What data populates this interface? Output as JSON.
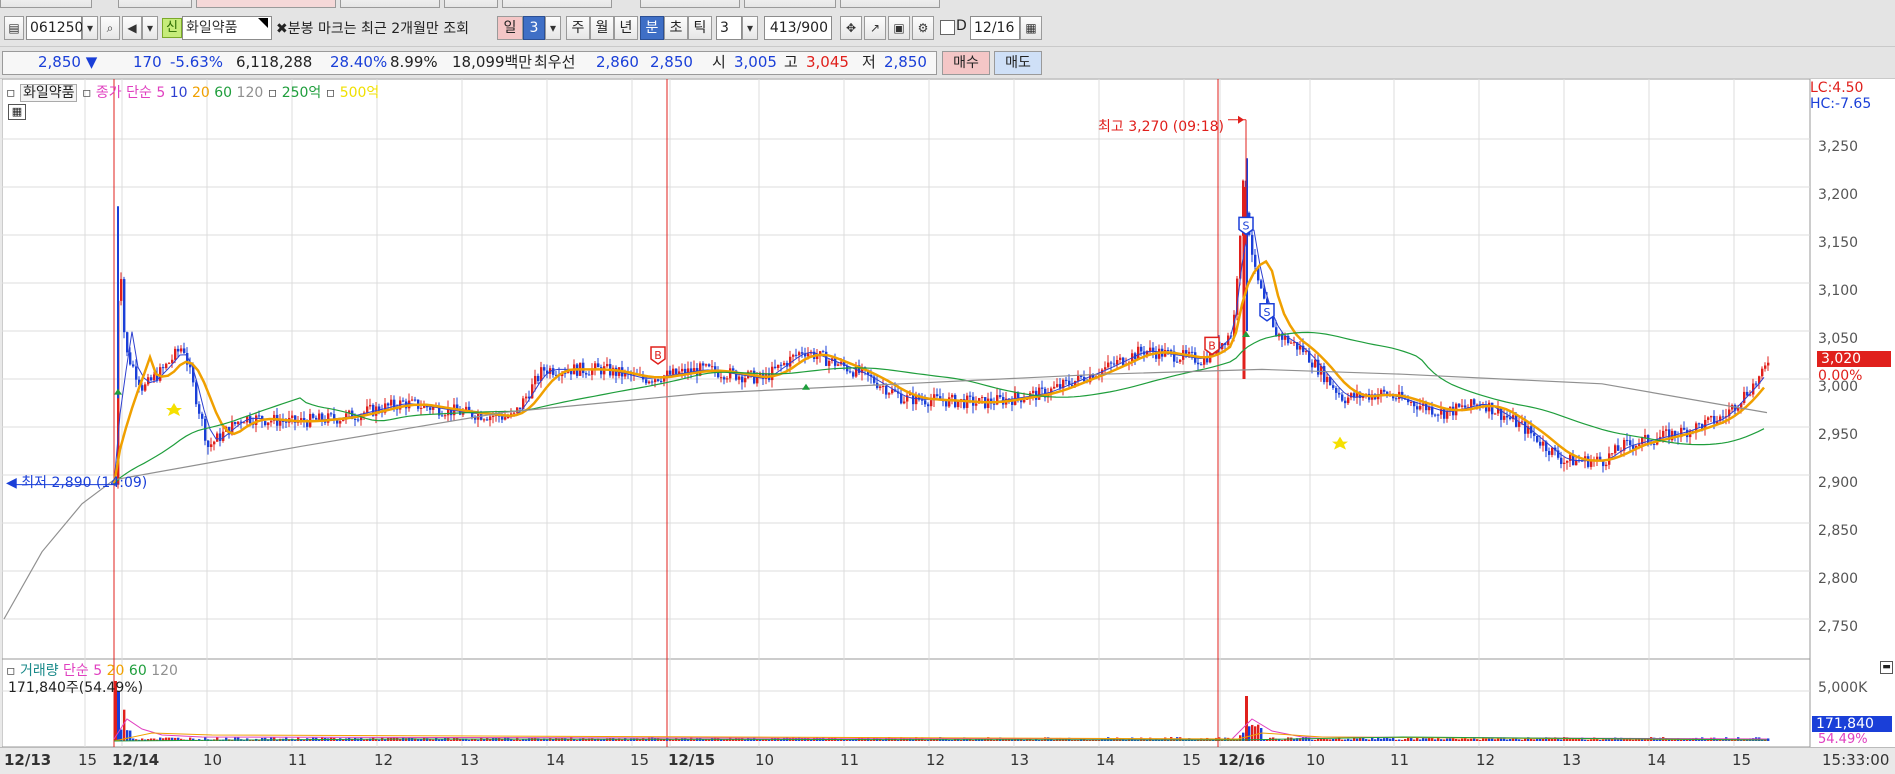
{
  "toolbar": {
    "code": "061250",
    "company": "화일약품",
    "notice": "분봉 마크는 최근 2개월만 조회",
    "period_day": "일",
    "period_num": "3",
    "period_week": "주",
    "period_month": "월",
    "period_year": "년",
    "period_min": "분",
    "period_sec": "초",
    "period_tick": "틱",
    "tick_num": "3",
    "count": "413",
    "count_total": "/900",
    "date": "12/16",
    "date_prefix": "D",
    "new_badge": "신"
  },
  "quote": {
    "price": "2,850",
    "change": "170",
    "change_pct": "-5.63%",
    "volume": "6,118,288",
    "vol_ratio": "28.40%",
    "turnover": "8.99%",
    "amount": "18,099백만",
    "best_label": "최우선",
    "ask": "2,860",
    "bid": "2,850",
    "open_label": "시",
    "open": "3,005",
    "high_label": "고",
    "high": "3,045",
    "low_label": "저",
    "low": "2,850",
    "buy": "매수",
    "sell": "매도"
  },
  "legend": {
    "name": "화일약품",
    "close_label": "종가 단순",
    "ma5": "5",
    "ma10": "10",
    "ma20": "20",
    "ma60": "60",
    "ma120": "120",
    "ma_250": "250억",
    "ma_500": "500억"
  },
  "annotations": {
    "high": "최고 3,270 (09:18)",
    "low": "최저 2,890 (14:09)",
    "lc": "LC:4.50",
    "hc": "HC:-7.65",
    "price_tag": "3,020",
    "pct_tag": "0.00%"
  },
  "yaxis": [
    "3,250",
    "3,200",
    "3,150",
    "3,100",
    "3,050",
    "3,000",
    "2,950",
    "2,900",
    "2,850",
    "2,800",
    "2,750"
  ],
  "volume_panel": {
    "legend_vol": "거래량",
    "legend_simple": "단순",
    "legend_5": "5",
    "legend_20": "20",
    "legend_60": "60",
    "legend_120": "120",
    "info": "171,840주(54.49%)",
    "axis_top": "5,000K",
    "vol_tag": "171,840",
    "vol_pct": "54.49%"
  },
  "xaxis": {
    "labels": [
      "12/13",
      "15",
      "12/14",
      "10",
      "11",
      "12",
      "13",
      "14",
      "15",
      "12/15",
      "10",
      "11",
      "12",
      "13",
      "14",
      "15",
      "12/16",
      "10",
      "11",
      "12",
      "13",
      "14",
      "15"
    ],
    "time": "15:33:00"
  },
  "colors": {
    "up": "#e0201c",
    "down": "#1a3fd8",
    "ma5": "#e040c0",
    "ma10": "#2d3fd0",
    "ma20": "#f0a000",
    "ma60": "#1f9e3c",
    "ma120": "#909090"
  },
  "chart_data": {
    "type": "candlestick",
    "ylim": [
      2730,
      3290
    ],
    "high": 3270,
    "low": 2890,
    "close": 3020
  }
}
